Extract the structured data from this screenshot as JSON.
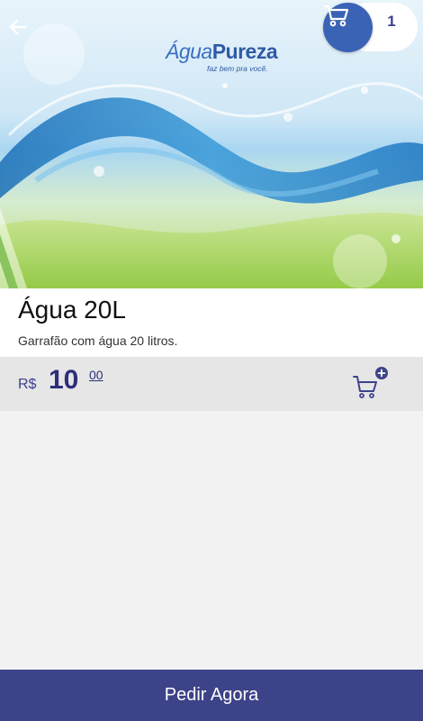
{
  "header": {
    "back_icon": "arrow-left-icon",
    "cart_icon": "shopping-cart-icon",
    "cart_count": "1"
  },
  "banner": {
    "logo_word_light": "Água",
    "logo_word_bold": "Pureza",
    "logo_tagline": "faz bem pra você."
  },
  "product": {
    "name": "Água 20L",
    "description": "Garrafão com água 20 litros.",
    "currency": "R$",
    "price_integer": "10",
    "price_decimal": "00",
    "add_to_cart_icon": "add-to-cart-icon"
  },
  "footer": {
    "order_label": "Pedir Agora"
  },
  "colors": {
    "primary": "#3d4388",
    "cart_circle": "#3b63b5",
    "price_text": "#2d2f7a"
  }
}
